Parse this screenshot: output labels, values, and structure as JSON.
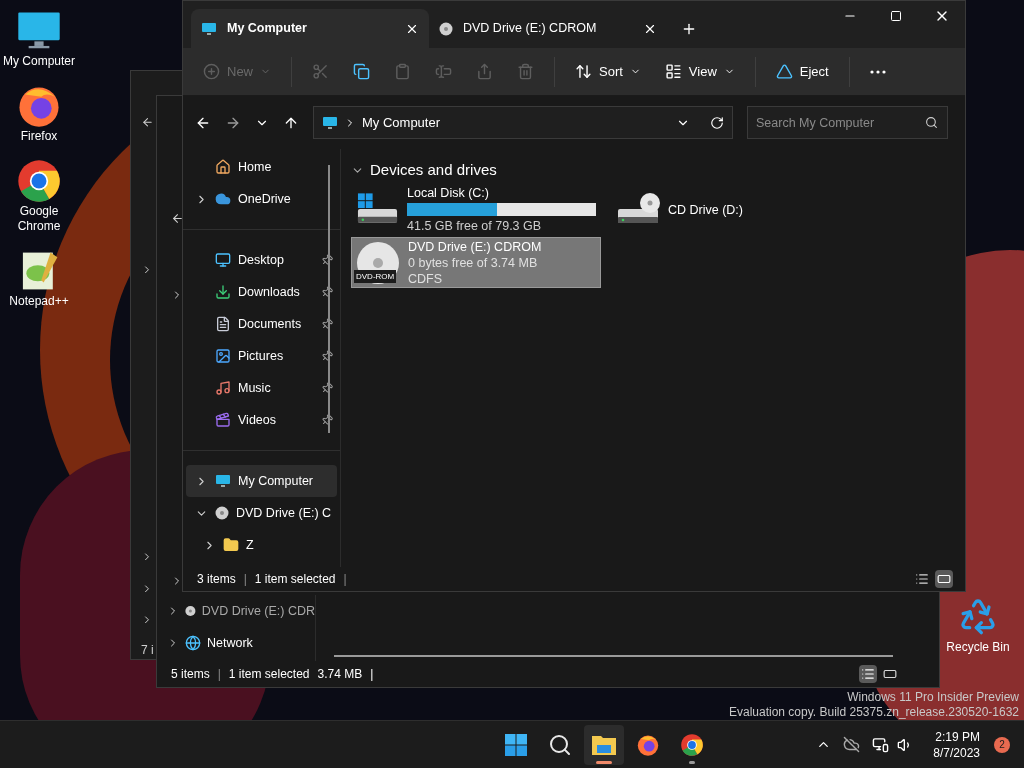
{
  "desktop_icons": [
    {
      "kind": "computer",
      "label": "My Computer"
    },
    {
      "kind": "firefox",
      "label": "Firefox"
    },
    {
      "kind": "chrome",
      "label": "Google Chrome"
    },
    {
      "kind": "notepad",
      "label": "Notepad++"
    }
  ],
  "recycle_bin": {
    "label": "Recycle Bin"
  },
  "back_window": {
    "status": "7 i"
  },
  "middle_window": {
    "nav": [
      {
        "kind": "dvd",
        "label": "DVD Drive (E:) CDR"
      },
      {
        "kind": "network",
        "label": "Network"
      }
    ],
    "status": [
      "5 items",
      "|",
      "1 item selected",
      "3.74 MB",
      "|"
    ],
    "view_modes": [
      {
        "kind": "details",
        "selected": true
      },
      {
        "kind": "tiles",
        "selected": false
      }
    ]
  },
  "explorer": {
    "tabs": [
      {
        "kind": "computer",
        "label": "My Computer",
        "selected": true
      },
      {
        "kind": "dvd",
        "label": "DVD Drive (E:) CDROM",
        "selected": false
      }
    ],
    "toolbar": [
      {
        "kind": "new",
        "label": "New",
        "disabled": true
      },
      {
        "kind": "cut",
        "disabled": true
      },
      {
        "kind": "copy",
        "disabled": false
      },
      {
        "kind": "paste",
        "disabled": true
      },
      {
        "kind": "rename",
        "disabled": true
      },
      {
        "kind": "share",
        "disabled": true
      },
      {
        "kind": "delete",
        "disabled": true
      },
      {
        "kind": "sort",
        "label": "Sort",
        "disabled": false
      },
      {
        "kind": "view",
        "label": "View",
        "disabled": false
      },
      {
        "kind": "eject",
        "label": "Eject",
        "disabled": false
      },
      {
        "kind": "more",
        "disabled": false
      }
    ],
    "address": {
      "path": "My Computer"
    },
    "search": {
      "placeholder": "Search My Computer"
    },
    "nav_groups": [
      [
        {
          "kind": "home",
          "label": "Home",
          "selected": false
        },
        {
          "kind": "cloud",
          "label": "OneDrive",
          "expanded": false,
          "selected": false
        }
      ],
      [
        {
          "kind": "desktop",
          "label": "Desktop",
          "pinned": true,
          "selected": false
        },
        {
          "kind": "downloads",
          "label": "Downloads",
          "pinned": true,
          "selected": false
        },
        {
          "kind": "documents",
          "label": "Documents",
          "pinned": true,
          "selected": false
        },
        {
          "kind": "pictures",
          "label": "Pictures",
          "pinned": true,
          "selected": false
        },
        {
          "kind": "music",
          "label": "Music",
          "pinned": true,
          "selected": false
        },
        {
          "kind": "videos",
          "label": "Videos",
          "pinned": true,
          "selected": false
        }
      ],
      [
        {
          "kind": "computer",
          "label": "My Computer",
          "expanded": false,
          "selected": true
        },
        {
          "kind": "dvd",
          "label": "DVD Drive (E:) C",
          "expanded": true,
          "selected": false,
          "children": [
            {
              "kind": "folder",
              "label": "Z",
              "expanded": false,
              "selected": false
            }
          ]
        }
      ]
    ],
    "section": {
      "title": "Devices and drives",
      "expanded": true,
      "drives": [
        {
          "kind": "system",
          "name": "Local Disk (C:)",
          "level": 0.477,
          "details": [
            "41.5 GB free of 79.3 GB"
          ],
          "selected": false
        },
        {
          "kind": "cd",
          "name": "CD Drive (D:)",
          "selected": false
        },
        {
          "kind": "dvd",
          "name": "DVD Drive (E:) CDROM",
          "icon_label": "DVD-ROM",
          "details": [
            "0 bytes free of 3.74 MB",
            "CDFS"
          ],
          "selected": true
        }
      ]
    },
    "status": [
      "3 items",
      "|",
      "1 item selected",
      "|"
    ],
    "view_modes": [
      {
        "kind": "details",
        "selected": false
      },
      {
        "kind": "tiles",
        "selected": true
      }
    ]
  },
  "watermark": [
    "Windows 11 Pro Insider Preview",
    "Evaluation copy. Build 25375.zn_release.230520-1632"
  ],
  "taskbar": {
    "apps": [
      {
        "kind": "start",
        "running": false,
        "active": false
      },
      {
        "kind": "search",
        "running": false,
        "active": false
      },
      {
        "kind": "explorer",
        "running": true,
        "active": true
      },
      {
        "kind": "firefox",
        "running": false,
        "active": false
      },
      {
        "kind": "chrome",
        "running": true,
        "active": false
      }
    ],
    "time": "2:19 PM",
    "date": "8/7/2023",
    "notifications": "2"
  }
}
